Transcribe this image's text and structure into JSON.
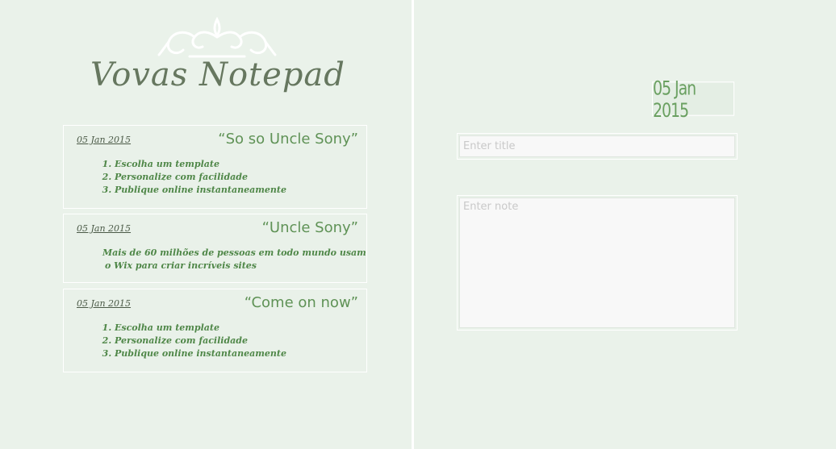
{
  "app": {
    "title": "Vovas Notepad"
  },
  "notes": [
    {
      "date": "05 Jan 2015",
      "title": "“So so Uncle Sony”",
      "body_type": "list",
      "items": [
        "Escolha um template",
        "Personalize com facilidade",
        "Publique online instantaneamente"
      ]
    },
    {
      "date": "05 Jan 2015",
      "title": "“Uncle Sony”",
      "body_type": "text",
      "lines": [
        "Mais de 60 milhões de pessoas em todo mundo usam",
        "o Wix para criar incríveis sites"
      ]
    },
    {
      "date": "05 Jan 2015",
      "title": "“Come on now”",
      "body_type": "list",
      "items": [
        "Escolha um template",
        "Personalize com facilidade",
        "Publique online instantaneamente"
      ]
    }
  ],
  "editor": {
    "date": "05 Jan 2015",
    "title_placeholder": "Enter title",
    "title_value": "",
    "note_placeholder": "Enter note",
    "note_value": ""
  },
  "colors": {
    "background": "#eaf2ea",
    "accent_green": "#5f9256",
    "title_gray_green": "#66775f",
    "border": "#ffffff"
  }
}
